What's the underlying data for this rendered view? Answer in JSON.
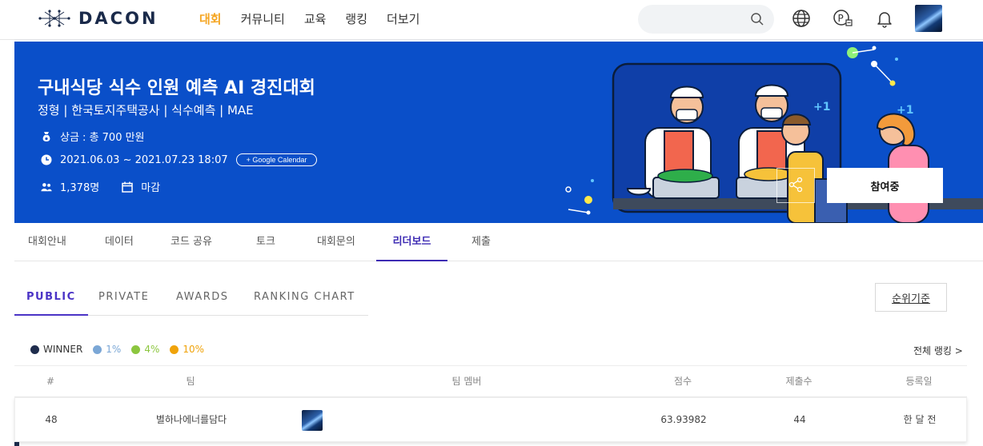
{
  "header": {
    "logo_text": "DACON",
    "nav": [
      "대회",
      "커뮤니티",
      "교육",
      "랭킹",
      "더보기"
    ],
    "search_placeholder": "",
    "icons": [
      "search-icon",
      "globe-icon",
      "point-icon",
      "bell-icon"
    ]
  },
  "banner": {
    "title": "구내식당 식수 인원 예측 AI 경진대회",
    "subtitle": "정형 | 한국토지주택공사 | 식수예측 | MAE",
    "prize": "상금 : 총 700 만원",
    "period": "2021.06.03 ~ 2021.07.23 18:07",
    "calendar_button": "+ Google Calendar",
    "participants": "1,378명",
    "status": "마감",
    "join_button": "참여중",
    "bg_color": "#0a4fc9"
  },
  "tabs": [
    "대회안내",
    "데이터",
    "코드 공유",
    "토크",
    "대회문의",
    "리더보드",
    "제출"
  ],
  "active_tab": "리더보드",
  "subtabs": [
    "PUBLIC",
    "PRIVATE",
    "AWARDS",
    "RANKING CHART"
  ],
  "active_subtab": "PUBLIC",
  "rank_criteria_button": "순위기준",
  "legend": [
    {
      "label": "WINNER",
      "color": "#1f2d4d"
    },
    {
      "label": "1%",
      "color": "#7ba7d6"
    },
    {
      "label": "4%",
      "color": "#8cc63f"
    },
    {
      "label": "10%",
      "color": "#f0a30a"
    }
  ],
  "all_ranking_link": "전체 랭킹 >",
  "table": {
    "columns": [
      "#",
      "팀",
      "팀 멤버",
      "점수",
      "제출수",
      "등록일"
    ],
    "rows": [
      {
        "rank": "48",
        "team": "별하나에너를담다",
        "score": "63.93982",
        "submissions": "44",
        "date": "한 달 전"
      }
    ]
  }
}
